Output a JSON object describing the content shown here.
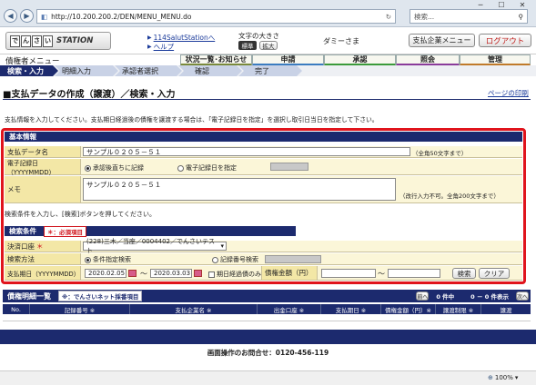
{
  "browser": {
    "url": "http://10.200.200.2/DEN/MENU_MENU.do",
    "search_placeholder": "検索...",
    "zoom": "100%"
  },
  "header": {
    "logo_chars": [
      "で",
      "ん",
      "さ",
      "い"
    ],
    "logo_suffix": "STATION",
    "link1": "114SalutStationへ",
    "link2": "ヘルプ",
    "font_size_label": "文字の大きさ",
    "font_std": "標準",
    "font_large": "拡大",
    "user": "ダミーさま",
    "company_menu": "支払企業メニュー",
    "logout": "ログアウト"
  },
  "menu": {
    "left_label": "債権者メニュー",
    "tabs": [
      "状況一覧･お知らせ",
      "申請",
      "承認",
      "照会",
      "管理"
    ]
  },
  "steps": [
    "検索・入力",
    "明細入力",
    "承認者選択",
    "確認",
    "完了"
  ],
  "page": {
    "title": "■支払データの作成（譲渡）／検索・入力",
    "print_link": "ページの印刷",
    "notice": "支払情報を入力してください。支払期日経過後の債権を譲渡する場合は、「電子記録日を指定」を選択し取引日当日を指定して下さい。"
  },
  "basic": {
    "header": "基本情報",
    "name_label": "支払データ名",
    "name_value": "サンプル０２０５－５１",
    "name_hint": "（全角50文字まで）",
    "date_label": "電子記録日（YYYYMMDD）",
    "radio1": "承認後直ちに記録",
    "radio2": "電子記録日を指定",
    "memo_label": "メモ",
    "memo_value": "サンプル０２０５－５１",
    "memo_hint": "（改行入力不可。全角200文字まで）"
  },
  "search": {
    "instruction": "検索条件を入力し、[検索]ボタンを押してください。",
    "header": "検索条件",
    "required_badge": "＊：必須項目",
    "account_label": "決済口座",
    "required_mark": "＊",
    "account_value": "(228)三木／当座／0004402／でんさいテスト",
    "method_label": "検索方法",
    "method1": "条件指定検索",
    "method2": "記録番号検索",
    "due_label": "支払期日（YYYYMMDD）",
    "date_from": "2020.02.05",
    "date_to": "2020.03.03",
    "tilde": "～",
    "overdue_only": "期日経過債のみ",
    "amount_label": "債権金額（円）",
    "search_btn": "検索",
    "clear_btn": "クリア"
  },
  "detail": {
    "header": "債権明細一覧",
    "sub_badge": "※：でんさいネット採番項目",
    "prev": "前へ",
    "count": "0 件中",
    "range": "0 － 0 件表示",
    "next": "次へ",
    "columns": [
      "No.",
      "記録番号 ※",
      "支払企業名 ※",
      "出金口座 ※",
      "支払期日 ※",
      "債権金額（円）※",
      "譲渡制限 ※",
      "譲渡"
    ]
  },
  "footer": {
    "inquiry": "画面操作のお問合せ：0120-456-119"
  }
}
